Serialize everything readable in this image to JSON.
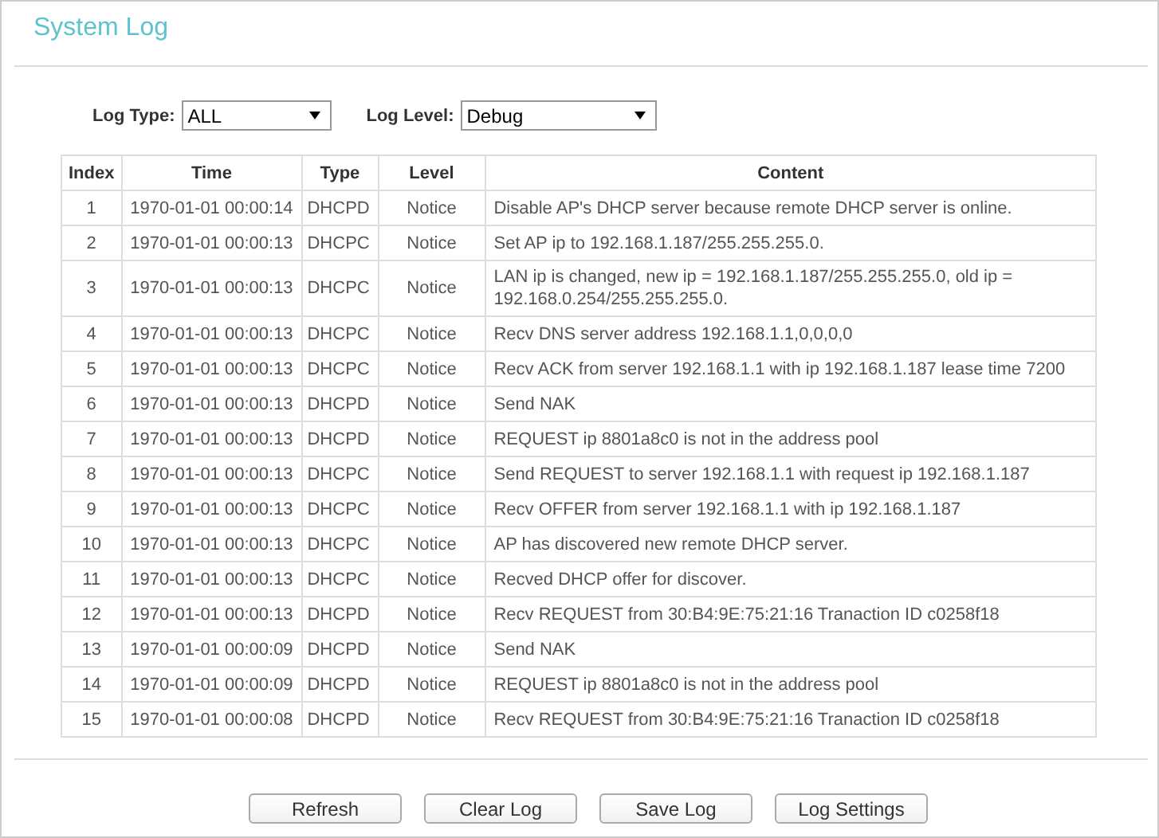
{
  "title": "System Log",
  "filters": [
    {
      "label": "Log Type:",
      "value": "ALL"
    },
    {
      "label": "Log Level:",
      "value": "Debug"
    }
  ],
  "table": {
    "columns": [
      "Index",
      "Time",
      "Type",
      "Level",
      "Content"
    ],
    "rows": [
      [
        "1",
        "1970-01-01 00:00:14",
        "DHCPD",
        "Notice",
        "Disable AP's DHCP server because remote DHCP server is online."
      ],
      [
        "2",
        "1970-01-01 00:00:13",
        "DHCPC",
        "Notice",
        "Set AP ip to 192.168.1.187/255.255.255.0."
      ],
      [
        "3",
        "1970-01-01 00:00:13",
        "DHCPC",
        "Notice",
        "LAN ip is changed, new ip = 192.168.1.187/255.255.255.0, old ip = 192.168.0.254/255.255.255.0."
      ],
      [
        "4",
        "1970-01-01 00:00:13",
        "DHCPC",
        "Notice",
        "Recv DNS server address 192.168.1.1,0,0,0,0"
      ],
      [
        "5",
        "1970-01-01 00:00:13",
        "DHCPC",
        "Notice",
        "Recv ACK from server 192.168.1.1 with ip 192.168.1.187 lease time 7200"
      ],
      [
        "6",
        "1970-01-01 00:00:13",
        "DHCPD",
        "Notice",
        "Send NAK"
      ],
      [
        "7",
        "1970-01-01 00:00:13",
        "DHCPD",
        "Notice",
        "REQUEST ip 8801a8c0 is not in the address pool"
      ],
      [
        "8",
        "1970-01-01 00:00:13",
        "DHCPC",
        "Notice",
        "Send REQUEST to server 192.168.1.1 with request ip 192.168.1.187"
      ],
      [
        "9",
        "1970-01-01 00:00:13",
        "DHCPC",
        "Notice",
        "Recv OFFER from server 192.168.1.1 with ip 192.168.1.187"
      ],
      [
        "10",
        "1970-01-01 00:00:13",
        "DHCPC",
        "Notice",
        "AP has discovered new remote DHCP server."
      ],
      [
        "11",
        "1970-01-01 00:00:13",
        "DHCPC",
        "Notice",
        "Recved DHCP offer for discover."
      ],
      [
        "12",
        "1970-01-01 00:00:13",
        "DHCPD",
        "Notice",
        "Recv REQUEST from 30:B4:9E:75:21:16 Tranaction ID c0258f18"
      ],
      [
        "13",
        "1970-01-01 00:00:09",
        "DHCPD",
        "Notice",
        "Send NAK"
      ],
      [
        "14",
        "1970-01-01 00:00:09",
        "DHCPD",
        "Notice",
        "REQUEST ip 8801a8c0 is not in the address pool"
      ],
      [
        "15",
        "1970-01-01 00:00:08",
        "DHCPD",
        "Notice",
        "Recv REQUEST from 30:B4:9E:75:21:16 Tranaction ID c0258f18"
      ]
    ]
  },
  "buttons": [
    "Refresh",
    "Clear Log",
    "Save Log",
    "Log Settings"
  ]
}
